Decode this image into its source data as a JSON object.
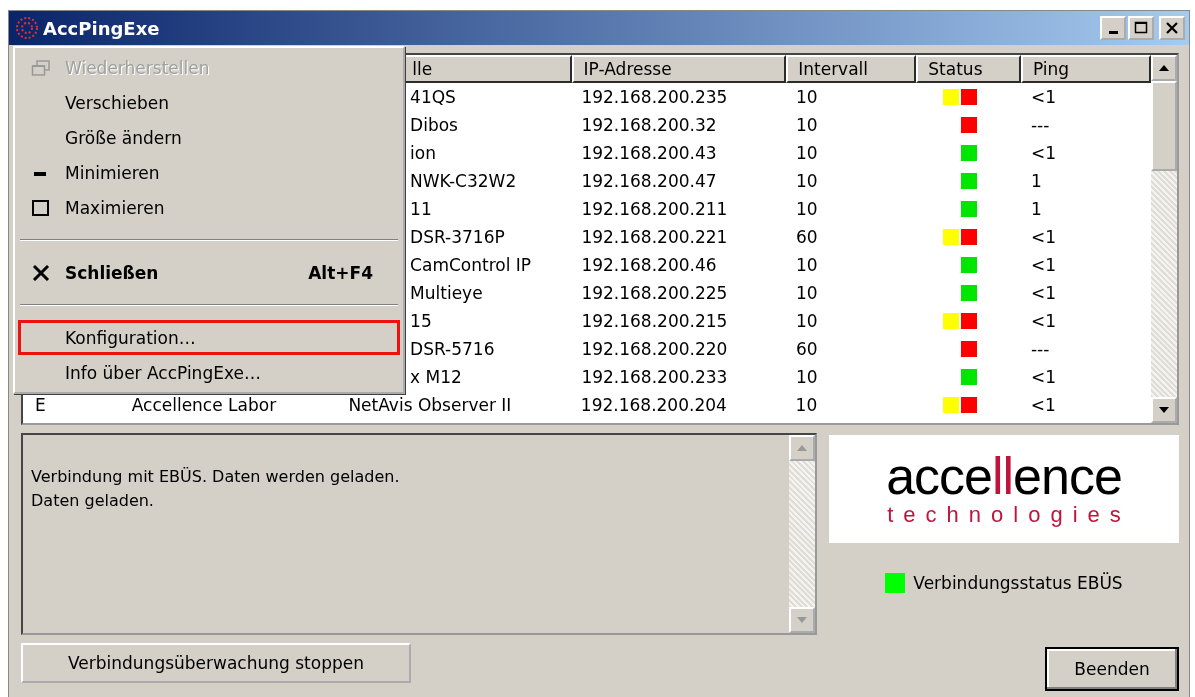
{
  "window": {
    "title": "AccPingExe"
  },
  "table": {
    "columns": [
      {},
      {},
      {
        "label": "lle"
      },
      {
        "label": "IP-Adresse"
      },
      {
        "label": "Intervall"
      },
      {
        "label": "Status"
      },
      {
        "label": "Ping"
      }
    ],
    "rows": [
      {
        "cells": [
          "",
          "",
          "41QS",
          "192.168.200.235",
          "10"
        ],
        "status": [
          {
            "color": "#ffff00"
          },
          {
            "color": "#ff0000"
          }
        ],
        "ping": "<1"
      },
      {
        "cells": [
          "",
          "",
          "Dibos",
          "192.168.200.32",
          "10"
        ],
        "status": [
          {
            "color": "#ff0000"
          }
        ],
        "ping": "---"
      },
      {
        "cells": [
          "",
          "",
          "ion",
          "192.168.200.43",
          "10"
        ],
        "status": [
          {
            "color": "#00e600"
          }
        ],
        "ping": "<1"
      },
      {
        "cells": [
          "",
          "",
          "NWK-C32W2",
          "192.168.200.47",
          "10"
        ],
        "status": [
          {
            "color": "#00e600"
          }
        ],
        "ping": "1"
      },
      {
        "cells": [
          "",
          "",
          "11",
          "192.168.200.211",
          "10"
        ],
        "status": [
          {
            "color": "#00e600"
          }
        ],
        "ping": "1"
      },
      {
        "cells": [
          "",
          "",
          "DSR-3716P",
          "192.168.200.221",
          "60"
        ],
        "status": [
          {
            "color": "#ffff00"
          },
          {
            "color": "#ff0000"
          }
        ],
        "ping": "<1"
      },
      {
        "cells": [
          "",
          "",
          "CamControl IP",
          "192.168.200.46",
          "10"
        ],
        "status": [
          {
            "color": "#00e600"
          }
        ],
        "ping": "<1"
      },
      {
        "cells": [
          "",
          "",
          "Multieye",
          "192.168.200.225",
          "10"
        ],
        "status": [
          {
            "color": "#00e600"
          }
        ],
        "ping": "<1"
      },
      {
        "cells": [
          "",
          "",
          "15",
          "192.168.200.215",
          "10"
        ],
        "status": [
          {
            "color": "#ffff00"
          },
          {
            "color": "#ff0000"
          }
        ],
        "ping": "<1"
      },
      {
        "cells": [
          "",
          "",
          "DSR-5716",
          "192.168.200.220",
          "60"
        ],
        "status": [
          {
            "color": "#ff0000"
          }
        ],
        "ping": "---"
      },
      {
        "cells": [
          "",
          "",
          "x M12",
          "192.168.200.233",
          "10"
        ],
        "status": [
          {
            "color": "#00e600"
          }
        ],
        "ping": "<1"
      },
      {
        "cells": [
          "E",
          "Accellence Labor",
          "NetAvis Observer II",
          "192.168.200.204",
          "10"
        ],
        "status": [
          {
            "color": "#ffff00"
          },
          {
            "color": "#ff0000"
          }
        ],
        "ping": "<1"
      }
    ]
  },
  "log": {
    "lines": [
      "Verbindung mit EBÜS. Daten werden geladen.",
      "Daten geladen."
    ]
  },
  "logo": {
    "parts": [
      {
        "text": "acce",
        "accent": false
      },
      {
        "text": "ll",
        "accent": true
      },
      {
        "text": "ence",
        "accent": false
      }
    ],
    "tagline": "technologies"
  },
  "connection_status": {
    "label": "Verbindungsstatus EBÜS",
    "color": "#00ff00"
  },
  "buttons": {
    "stop": "Verbindungsüberwachung stoppen",
    "exit": "Beenden"
  },
  "system_menu": {
    "items": [
      {
        "kind": "restore",
        "label": "Wiederherstellen",
        "disabled": true,
        "highlighted": false
      },
      {
        "kind": "plain",
        "label": "Verschieben",
        "disabled": false,
        "highlighted": false
      },
      {
        "kind": "plain",
        "label": "Größe ändern",
        "disabled": false,
        "highlighted": false
      },
      {
        "kind": "minimize",
        "label": "Minimieren",
        "disabled": false,
        "highlighted": false
      },
      {
        "kind": "maximize",
        "label": "Maximieren",
        "disabled": false,
        "highlighted": false
      },
      {
        "kind": "separator"
      },
      {
        "kind": "close",
        "label": "Schließen",
        "shortcut": "Alt+F4",
        "disabled": false,
        "highlighted": false
      },
      {
        "kind": "separator"
      },
      {
        "kind": "plain",
        "label": "Konfiguration…",
        "disabled": false,
        "highlighted": true
      },
      {
        "kind": "plain",
        "label": "Info über AccPingExe…",
        "disabled": false,
        "highlighted": false
      }
    ]
  }
}
